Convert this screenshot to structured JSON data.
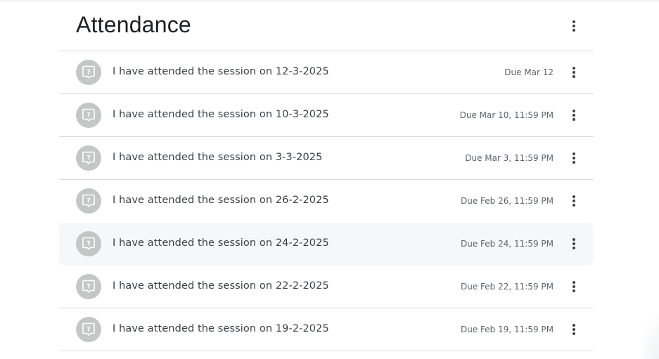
{
  "header": {
    "title": "Attendance"
  },
  "assignments": [
    {
      "title": "I have attended the session on 12-3-2025",
      "due": "Due Mar 12"
    },
    {
      "title": "I have attended the session on 10-3-2025",
      "due": "Due Mar 10, 11:59 PM"
    },
    {
      "title": "I have attended the session on 3-3-2025",
      "due": "Due Mar 3, 11:59 PM"
    },
    {
      "title": "I have attended the session on 26-2-2025",
      "due": "Due Feb 26, 11:59 PM"
    },
    {
      "title": "I have attended the session on 24-2-2025",
      "due": "Due Feb 24, 11:59 PM"
    },
    {
      "title": "I have attended the session on 22-2-2025",
      "due": "Due Feb 22, 11:59 PM"
    },
    {
      "title": "I have attended the session on 19-2-2025",
      "due": "Due Feb 19, 11:59 PM"
    }
  ],
  "icons": {
    "assignment": "question-assignment-icon",
    "menu": "more-vert-icon"
  },
  "colors": {
    "icon_background": "#c4c7c5",
    "divider": "#dadce0",
    "hover_row": "#f6f7f9",
    "title_text": "#202124"
  }
}
